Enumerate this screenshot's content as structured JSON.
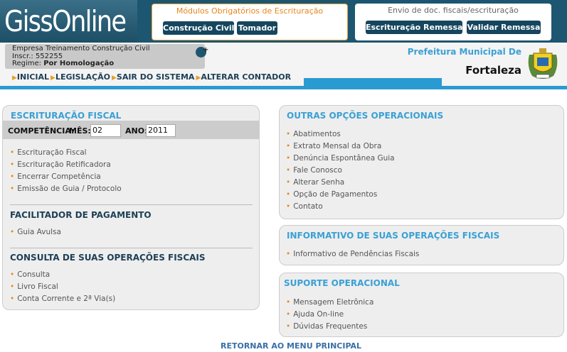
{
  "header": {
    "logo_text": "GissOnline",
    "modules": {
      "title": "Módulos Obrigatórios de Escrituração",
      "buttons": [
        "Construção Civil",
        "Tomador"
      ]
    },
    "envio": {
      "title": "Envio de doc. fiscais/escrituração",
      "buttons": [
        "Escrituração Remessa",
        "Validar Remessa"
      ]
    }
  },
  "company": {
    "name": "Empresa Treinamento Construção Civil",
    "inscr": "Inscr.: 552255",
    "regime_label": "Regime: ",
    "regime_value": "Por Homologação"
  },
  "nav": [
    "INICIAL",
    "LEGISLAÇÃO",
    "SAIR DO SISTEMA",
    "ALTERAR CONTADOR"
  ],
  "prefeitura": {
    "label": "Prefeitura Municipal De",
    "city": "Fortaleza"
  },
  "left_panel": {
    "escrituracao": {
      "title": "ESCRITURAÇÃO FISCAL",
      "competencia_label": "COMPETÊNCIA:",
      "mes_label": "MÊS:",
      "mes_value": "02",
      "ano_label": "ANO:",
      "ano_value": "2011",
      "links": [
        "Escrituração Fiscal",
        "Escrituração Retificadora",
        "Encerrar Competência",
        "Emissão de Guia / Protocolo"
      ]
    },
    "facilitador": {
      "title": "FACILITADOR DE PAGAMENTO",
      "links": [
        "Guia Avulsa"
      ]
    },
    "consulta": {
      "title": "CONSULTA DE SUAS OPERAÇÕES FISCAIS",
      "links": [
        "Consulta",
        "Livro Fiscal",
        "Conta Corrente e 2ª Via(s)"
      ]
    }
  },
  "outras": {
    "title": "OUTRAS OPÇÕES OPERACIONAIS",
    "links": [
      "Abatimentos",
      "Extrato Mensal da Obra",
      "Denúncia Espontânea Guia",
      "Fale Conosco",
      "Alterar Senha",
      "Opção de Pagamentos",
      "Contato"
    ]
  },
  "informativo": {
    "title": "INFORMATIVO DE SUAS OPERAÇÕES FISCAIS",
    "links": [
      "Informativo de Pendências Fiscais"
    ]
  },
  "suporte": {
    "title": "SUPORTE OPERACIONAL",
    "links": [
      "Mensagem Eletrônica",
      "Ajuda On-line",
      "Dúvidas Frequentes"
    ]
  },
  "footer": {
    "link": "RETORNAR AO MENU PRINCIPAL"
  }
}
